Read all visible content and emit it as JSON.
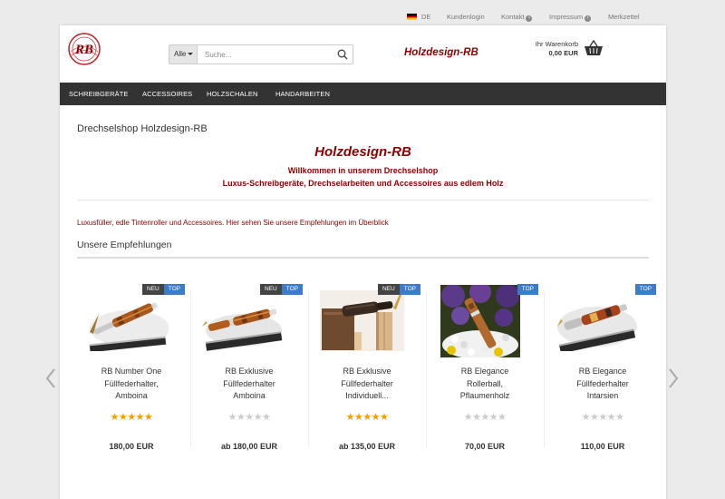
{
  "topbar": {
    "language": "DE",
    "customer_login": "Kundenlogin",
    "contact": "Kontakt",
    "imprint": "Impressum",
    "wishlist": "Merkzettel"
  },
  "header": {
    "logo_text": "RB",
    "search": {
      "category": "Alle",
      "placeholder": "Suche..."
    },
    "brand": "Holzdesign-RB",
    "cart": {
      "label": "Ihr Warenkorb",
      "amount": "0,00 EUR"
    }
  },
  "nav": {
    "items": [
      "SCHREIBGERÄTE",
      "ACCESSOIRES",
      "HOLZSCHALEN",
      "HANDARBEITEN"
    ]
  },
  "main": {
    "page_title": "Drechselshop Holzdesign-RB",
    "hero_title": "Holzdesign-RB",
    "hero_line1": "Willkommen in unserem Drechselshop",
    "hero_line2": "Luxus-Schreibgeräte, Drechselarbeiten und Accessoires aus edlem Holz",
    "intro": "Luxusfüller, edle Tintenroller und Accessoires. Hier sehen Sie unsere Empfehlungen im Überblick",
    "section_title": "Unsere Empfehlungen"
  },
  "products": [
    {
      "name_lines": [
        "RB Number One",
        "Füllfederhalter,",
        "Amboina"
      ],
      "badges": [
        "NEU",
        "TOP"
      ],
      "rating": 5,
      "stars": "★★★★★",
      "price": "180,00 EUR"
    },
    {
      "name_lines": [
        "RB Exklusive",
        "Füllfederhalter",
        "Amboina"
      ],
      "badges": [
        "NEU",
        "TOP"
      ],
      "rating": 0,
      "stars": "★★★★★",
      "price": "ab 180,00 EUR"
    },
    {
      "name_lines": [
        "RB Exklusive",
        "Füllfederhalter",
        "Individuell..."
      ],
      "badges": [
        "NEU",
        "TOP"
      ],
      "rating": 5,
      "stars": "★★★★★",
      "price": "ab 135,00 EUR"
    },
    {
      "name_lines": [
        "RB Elegance",
        "Rollerball,",
        "Pflaumenholz"
      ],
      "badges": [
        "TOP"
      ],
      "rating": 0,
      "stars": "★★★★★",
      "price": "70,00 EUR"
    },
    {
      "name_lines": [
        "RB Elegance",
        "Füllfederhalter",
        "Intarsien"
      ],
      "badges": [
        "TOP"
      ],
      "rating": 0,
      "stars": "★★★★★",
      "price": "110,00 EUR"
    }
  ],
  "colors": {
    "brand_red": "#8b0000",
    "nav_bg": "#333333",
    "badge_top": "#3d7cc9",
    "badge_neu": "#444444",
    "star_filled": "#f0a000",
    "star_empty": "#cccccc"
  },
  "icons": {
    "flag": "german-flag-icon",
    "contact": "circle-arrow-icon",
    "search": "search-icon",
    "cart": "basket-icon",
    "carousel_prev": "chevron-left-icon",
    "carousel_next": "chevron-right-icon"
  }
}
